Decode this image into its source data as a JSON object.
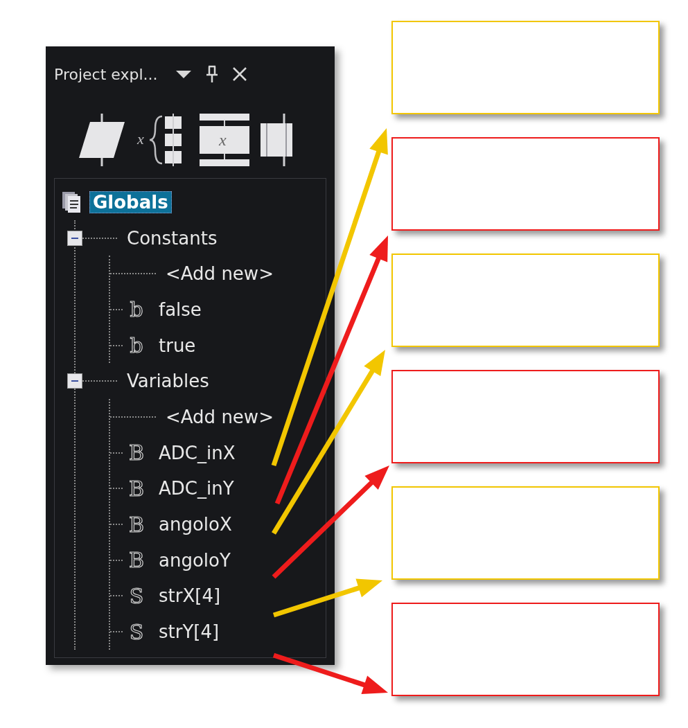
{
  "panel": {
    "title": "Project expl...",
    "toolbar": [
      {
        "kind": "input"
      },
      {
        "kind": "switch",
        "label": "x"
      },
      {
        "kind": "assign",
        "label": "x"
      },
      {
        "kind": "call"
      }
    ]
  },
  "tree": {
    "label": "Globals",
    "selected": true,
    "children": [
      {
        "label": "Constants",
        "expanded": true,
        "children": [
          {
            "kind": "add",
            "label": "<Add new>"
          },
          {
            "kind": "item",
            "glyph": "b",
            "label": "false"
          },
          {
            "kind": "item",
            "glyph": "b",
            "label": "true"
          }
        ]
      },
      {
        "label": "Variables",
        "expanded": true,
        "children": [
          {
            "kind": "add",
            "label": "<Add new>"
          },
          {
            "kind": "item",
            "glyph": "B",
            "label": "ADC_inX"
          },
          {
            "kind": "item",
            "glyph": "B",
            "label": "ADC_inY"
          },
          {
            "kind": "item",
            "glyph": "B",
            "label": "angoloX"
          },
          {
            "kind": "item",
            "glyph": "B",
            "label": "angoloY"
          },
          {
            "kind": "item",
            "glyph": "S",
            "label": "strX[4]"
          },
          {
            "kind": "item",
            "glyph": "S",
            "label": "strY[4]"
          }
        ]
      }
    ]
  },
  "callouts": [
    {
      "color": "#f2c600"
    },
    {
      "color": "#ee1c1c"
    },
    {
      "color": "#f2c600"
    },
    {
      "color": "#ee1c1c"
    },
    {
      "color": "#f2c600"
    },
    {
      "color": "#ee1c1c"
    }
  ]
}
